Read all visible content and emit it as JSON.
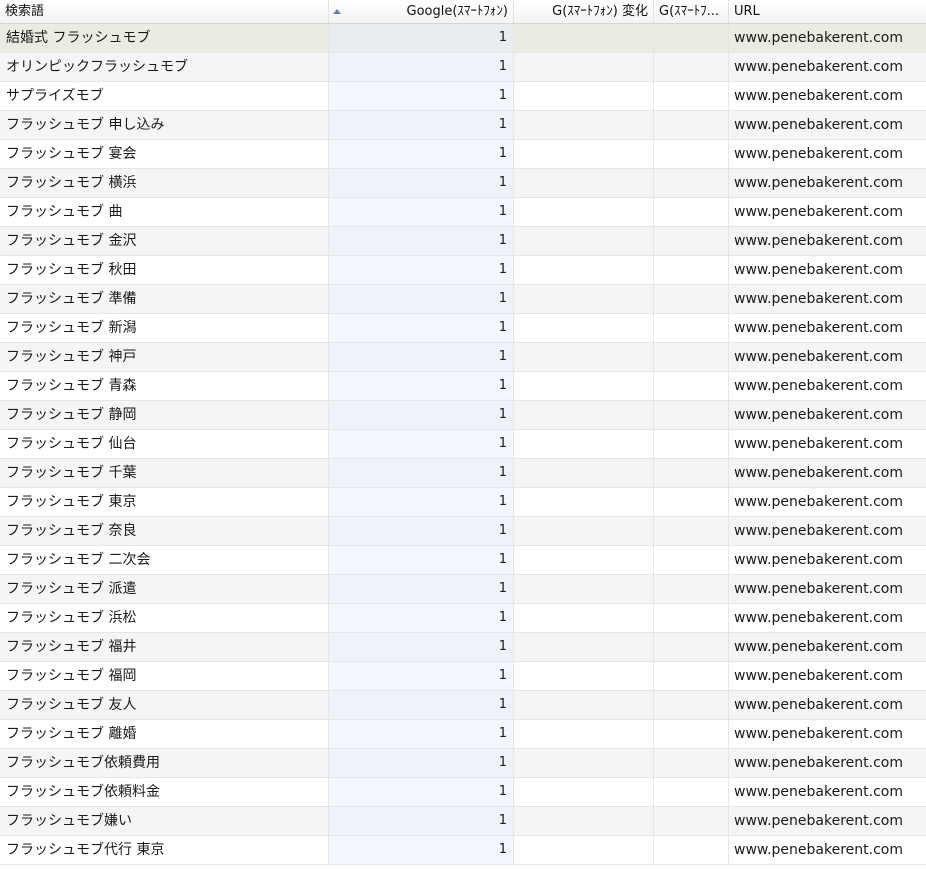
{
  "columns": [
    {
      "label": "検索語"
    },
    {
      "label": "Google(ｽﾏｰﾄﾌｫﾝ)"
    },
    {
      "label": "G(ｽﾏｰﾄﾌｫﾝ) 変化"
    },
    {
      "label": "G(ｽﾏｰﾄﾌ..."
    },
    {
      "label": "URL"
    }
  ],
  "sort": {
    "column": 1,
    "direction": "ascending",
    "icon": "sort-ascending-triangle-icon",
    "color": "#5b7fc2"
  },
  "rows": [
    {
      "term": "結婚式 フラッシュモブ",
      "rank": "1",
      "change": "",
      "extra": "",
      "url": "www.penebakerent.com"
    },
    {
      "term": "オリンピックフラッシュモブ",
      "rank": "1",
      "change": "",
      "extra": "",
      "url": "www.penebakerent.com"
    },
    {
      "term": "サプライズモブ",
      "rank": "1",
      "change": "",
      "extra": "",
      "url": "www.penebakerent.com"
    },
    {
      "term": "フラッシュモブ 申し込み",
      "rank": "1",
      "change": "",
      "extra": "",
      "url": "www.penebakerent.com"
    },
    {
      "term": "フラッシュモブ 宴会",
      "rank": "1",
      "change": "",
      "extra": "",
      "url": "www.penebakerent.com"
    },
    {
      "term": "フラッシュモブ 横浜",
      "rank": "1",
      "change": "",
      "extra": "",
      "url": "www.penebakerent.com"
    },
    {
      "term": "フラッシュモブ 曲",
      "rank": "1",
      "change": "",
      "extra": "",
      "url": "www.penebakerent.com"
    },
    {
      "term": "フラッシュモブ 金沢",
      "rank": "1",
      "change": "",
      "extra": "",
      "url": "www.penebakerent.com"
    },
    {
      "term": "フラッシュモブ 秋田",
      "rank": "1",
      "change": "",
      "extra": "",
      "url": "www.penebakerent.com"
    },
    {
      "term": "フラッシュモブ 準備",
      "rank": "1",
      "change": "",
      "extra": "",
      "url": "www.penebakerent.com"
    },
    {
      "term": "フラッシュモブ 新潟",
      "rank": "1",
      "change": "",
      "extra": "",
      "url": "www.penebakerent.com"
    },
    {
      "term": "フラッシュモブ 神戸",
      "rank": "1",
      "change": "",
      "extra": "",
      "url": "www.penebakerent.com"
    },
    {
      "term": "フラッシュモブ 青森",
      "rank": "1",
      "change": "",
      "extra": "",
      "url": "www.penebakerent.com"
    },
    {
      "term": "フラッシュモブ 静岡",
      "rank": "1",
      "change": "",
      "extra": "",
      "url": "www.penebakerent.com"
    },
    {
      "term": "フラッシュモブ 仙台",
      "rank": "1",
      "change": "",
      "extra": "",
      "url": "www.penebakerent.com"
    },
    {
      "term": "フラッシュモブ 千葉",
      "rank": "1",
      "change": "",
      "extra": "",
      "url": "www.penebakerent.com"
    },
    {
      "term": "フラッシュモブ 東京",
      "rank": "1",
      "change": "",
      "extra": "",
      "url": "www.penebakerent.com"
    },
    {
      "term": "フラッシュモブ 奈良",
      "rank": "1",
      "change": "",
      "extra": "",
      "url": "www.penebakerent.com"
    },
    {
      "term": "フラッシュモブ 二次会",
      "rank": "1",
      "change": "",
      "extra": "",
      "url": "www.penebakerent.com"
    },
    {
      "term": "フラッシュモブ 派遣",
      "rank": "1",
      "change": "",
      "extra": "",
      "url": "www.penebakerent.com"
    },
    {
      "term": "フラッシュモブ 浜松",
      "rank": "1",
      "change": "",
      "extra": "",
      "url": "www.penebakerent.com"
    },
    {
      "term": "フラッシュモブ 福井",
      "rank": "1",
      "change": "",
      "extra": "",
      "url": "www.penebakerent.com"
    },
    {
      "term": "フラッシュモブ 福岡",
      "rank": "1",
      "change": "",
      "extra": "",
      "url": "www.penebakerent.com"
    },
    {
      "term": "フラッシュモブ 友人",
      "rank": "1",
      "change": "",
      "extra": "",
      "url": "www.penebakerent.com"
    },
    {
      "term": "フラッシュモブ 離婚",
      "rank": "1",
      "change": "",
      "extra": "",
      "url": "www.penebakerent.com"
    },
    {
      "term": "フラッシュモブ依頼費用",
      "rank": "1",
      "change": "",
      "extra": "",
      "url": "www.penebakerent.com"
    },
    {
      "term": "フラッシュモブ依頼料金",
      "rank": "1",
      "change": "",
      "extra": "",
      "url": "www.penebakerent.com"
    },
    {
      "term": "フラッシュモブ嫌い",
      "rank": "1",
      "change": "",
      "extra": "",
      "url": "www.penebakerent.com"
    },
    {
      "term": "フラッシュモブ代行 東京",
      "rank": "1",
      "change": "",
      "extra": "",
      "url": "www.penebakerent.com"
    }
  ],
  "selected_row": 0,
  "colors": {
    "selected_row": "#ecebe2",
    "alt_row": "#f5f5f5",
    "rank_column_tint": "#e6f0fc"
  }
}
